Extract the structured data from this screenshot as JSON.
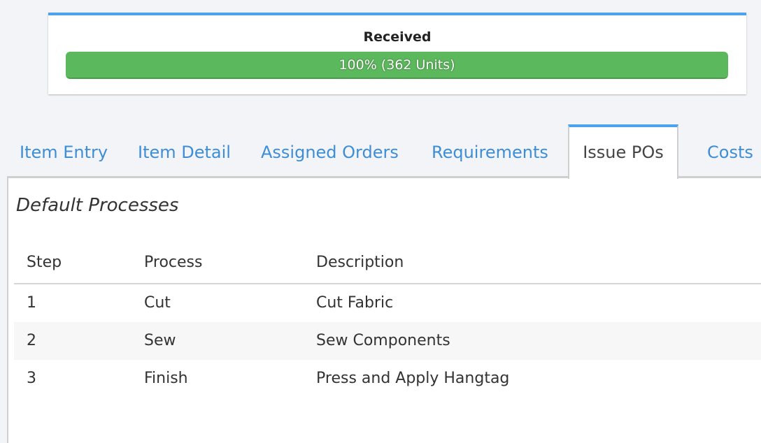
{
  "received": {
    "title": "Received",
    "progress_percent": 100,
    "progress_label": "100% (362 Units)",
    "units": 362,
    "bar_color": "#5cb85c",
    "accent_color": "#4aa3ec"
  },
  "tabs": [
    {
      "label": "Item Entry",
      "active": false
    },
    {
      "label": "Item Detail",
      "active": false
    },
    {
      "label": "Assigned Orders",
      "active": false
    },
    {
      "label": "Requirements",
      "active": false
    },
    {
      "label": "Issue POs",
      "active": true
    },
    {
      "label": "Costs",
      "active": false
    }
  ],
  "panel": {
    "title": "Default Processes",
    "table": {
      "headers": [
        "Step",
        "Process",
        "Description"
      ],
      "rows": [
        {
          "step": "1",
          "process": "Cut",
          "description": "Cut Fabric"
        },
        {
          "step": "2",
          "process": "Sew",
          "description": "Sew Components"
        },
        {
          "step": "3",
          "process": "Finish",
          "description": "Press and Apply Hangtag"
        }
      ]
    }
  }
}
